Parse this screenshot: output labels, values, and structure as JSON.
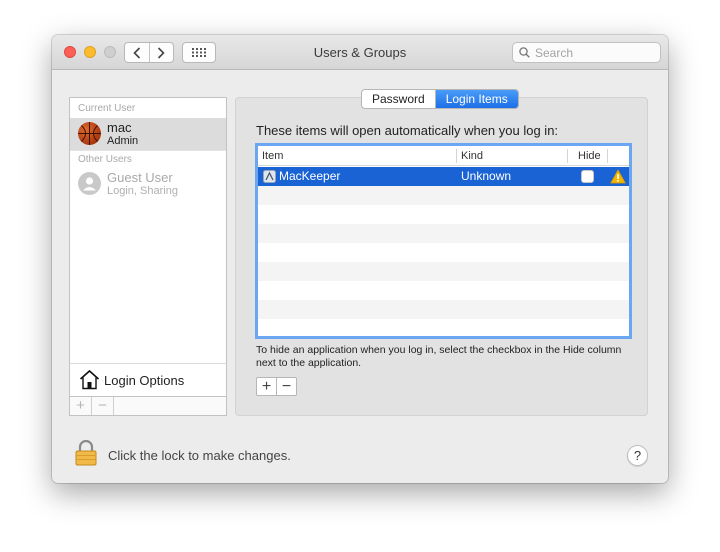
{
  "window": {
    "title": "Users & Groups",
    "search_placeholder": "Search"
  },
  "sidebar": {
    "current_user_heading": "Current User",
    "other_users_heading": "Other Users",
    "current_user": {
      "name": "mac",
      "role": "Admin"
    },
    "guest_user": {
      "name": "Guest User",
      "detail": "Login, Sharing"
    },
    "login_options_label": "Login Options",
    "add_label": "+",
    "remove_label": "−"
  },
  "tabs": [
    {
      "label": "Password",
      "active": false
    },
    {
      "label": "Login Items",
      "active": true
    }
  ],
  "login_items": {
    "intro": "These items will open automatically when you log in:",
    "columns": {
      "item": "Item",
      "kind": "Kind",
      "hide": "Hide"
    },
    "rows": [
      {
        "item": "MacKeeper",
        "kind": "Unknown",
        "hide": false,
        "warning": true
      }
    ],
    "help_text": "To hide an application when you log in, select the checkbox in the Hide column next to the application.",
    "add_label": "+",
    "remove_label": "−"
  },
  "footer": {
    "lock_text": "Click the lock to make changes.",
    "help_label": "?"
  },
  "colors": {
    "selection": "#1a63d5",
    "tab_active": "#2c7ef0",
    "table_focus": "#6aa6f1",
    "warning": "#f5b400"
  }
}
